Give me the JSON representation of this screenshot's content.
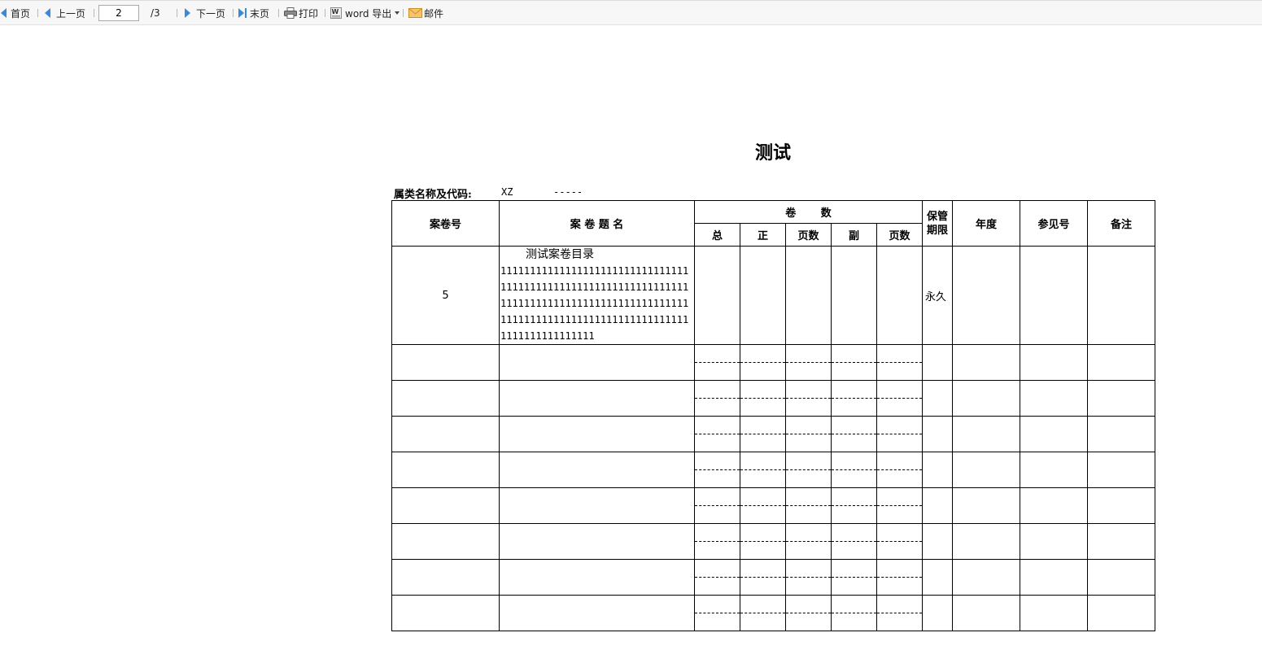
{
  "toolbar": {
    "first": "首页",
    "prev": "上一页",
    "page_current": "2",
    "page_total": "/3",
    "next": "下一页",
    "last": "末页",
    "print": "打印",
    "export": "word 导出",
    "mail": "邮件"
  },
  "document": {
    "title": "测试",
    "category_label": "属类名称及代码:",
    "category_code": "XZ",
    "category_dash": "-----"
  },
  "table": {
    "headers": {
      "file_no": "案卷号",
      "file_title": "案 卷 题 名",
      "volumes": "卷 数",
      "total": "总",
      "main": "正",
      "pages1": "页数",
      "copy": "副",
      "pages2": "页数",
      "retention": "保管期限",
      "year": "年度",
      "ref_no": "参见号",
      "remark": "备注"
    },
    "rows": [
      {
        "file_no": "5",
        "title_head": "测试案卷目录",
        "title_body": "111111111111111111111111111111111111111111111111111111111111111111111111111111111111111111111111111111111111111111111111111111111111111111111111",
        "retention": "永久",
        "year": "",
        "ref_no": "",
        "remark": ""
      }
    ]
  }
}
